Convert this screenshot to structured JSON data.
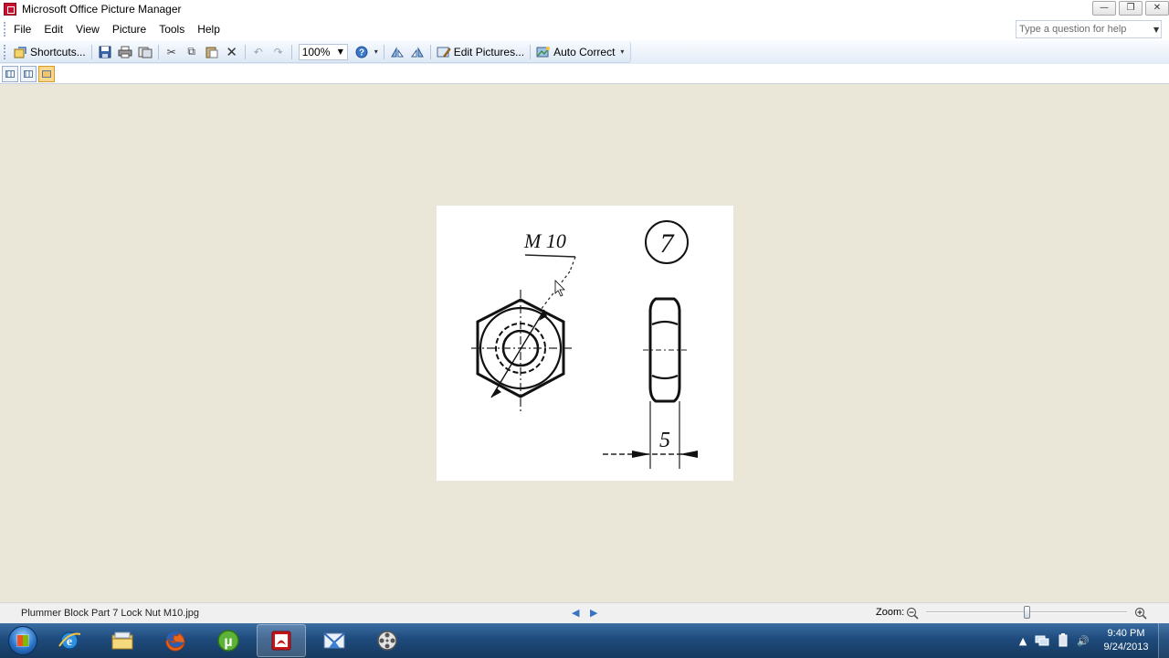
{
  "window": {
    "title": "Microsoft Office Picture Manager",
    "controls": {
      "minimize": "—",
      "restore": "❐",
      "close": "✕"
    }
  },
  "menubar": {
    "items": [
      "File",
      "Edit",
      "View",
      "Picture",
      "Tools",
      "Help"
    ],
    "help_placeholder": "Type a question for help"
  },
  "toolbar": {
    "shortcuts_label": "Shortcuts...",
    "zoom_value": "100%",
    "edit_pictures_label": "Edit Pictures...",
    "auto_correct_label": "Auto Correct"
  },
  "drawing": {
    "spec_label": "M 10",
    "part_number": "7",
    "dimension_label": "5"
  },
  "statusbar": {
    "file_name": "Plummer Block Part 7 Lock Nut M10.jpg",
    "zoom_label": "Zoom:",
    "zoom_level": 0.5
  },
  "taskbar": {
    "apps": [
      "internet-explorer",
      "windows-explorer",
      "firefox",
      "utorrent",
      "acrobat-reader",
      "mail-app",
      "media-player"
    ],
    "clock_time": "9:40 PM",
    "clock_date": "9/24/2013"
  }
}
